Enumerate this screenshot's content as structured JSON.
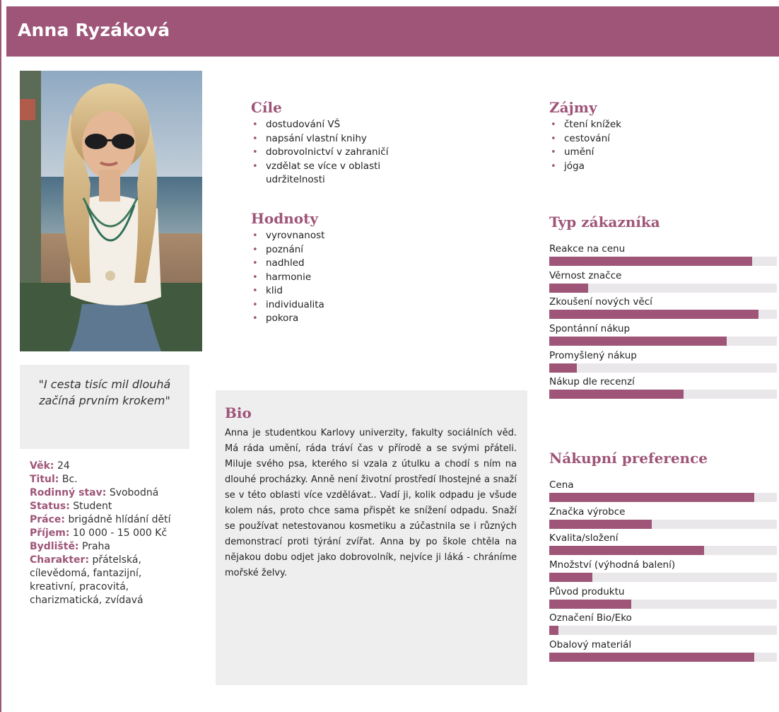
{
  "header": {
    "name": "Anna Ryzáková"
  },
  "quote": "\"I cesta tisíc mil dlouhá začíná prvním krokem\"",
  "info": [
    {
      "key": "Věk:",
      "value": "24"
    },
    {
      "key": "Titul:",
      "value": "Bc."
    },
    {
      "key": "Rodinný stav:",
      "value": "Svobodná"
    },
    {
      "key": "Status:",
      "value": "Student"
    },
    {
      "key": "Práce:",
      "value": "brigádně hlídání dětí"
    },
    {
      "key": "Příjem:",
      "value": "10 000 - 15 000 Kč"
    },
    {
      "key": "Bydliště:",
      "value": "Praha"
    },
    {
      "key": "Charakter:",
      "value": "přátelská, cílevědomá, fantazijní, kreativní, pracovitá, charizmatická, zvídavá"
    }
  ],
  "goals": {
    "title": "Cíle",
    "items": [
      "dostudování VŠ",
      "napsání vlastní knihy",
      "dobrovolnictví v zahraničí",
      "vzdělat se více v oblasti udržitelnosti"
    ]
  },
  "values": {
    "title": "Hodnoty",
    "items": [
      "vyrovnanost",
      "poznání",
      "nadhled",
      "harmonie",
      "klid",
      "individualita",
      "pokora"
    ]
  },
  "interests": {
    "title": "Zájmy",
    "items": [
      "čtení knížek",
      "cestování",
      "umění",
      "jóga"
    ]
  },
  "bio": {
    "title": "Bio",
    "text": "Anna je studentkou Karlovy univerzity, fakulty sociálních věd. Má ráda umění, ráda tráví čas v přírodě a se svými přáteli. Miluje svého psa, kterého si vzala z útulku a chodí s ním na dlouhé procházky. Anně není životní prostředí lhostejné a snaží se v této oblasti více vzdělávat.. Vadí ji, kolik odpadu je všude kolem nás, proto chce sama přispět ke snížení odpadu. Snaží se používat netestovanou kosmetiku a zúčastnila se i různých demonstrací proti týrání zvířat. Anna by po škole chtěla na nějakou dobu odjet jako dobrovolník, nejvíce ji láká - chráníme mořské želvy."
  },
  "customer_type": {
    "title": "Typ zákazníka",
    "bars": [
      {
        "label": "Reakce na cenu",
        "level": 0.89
      },
      {
        "label": "Věrnost značce",
        "level": 0.17
      },
      {
        "label": "Zkoušení nových věcí",
        "level": 0.92
      },
      {
        "label": "Spontánní nákup",
        "level": 0.78
      },
      {
        "label": "Promyšlený nákup",
        "level": 0.12
      },
      {
        "label": "Nákup dle recenzí",
        "level": 0.59
      }
    ]
  },
  "shopping_prefs": {
    "title": "Nákupní preference",
    "bars": [
      {
        "label": "Cena",
        "level": 0.9
      },
      {
        "label": "Značka výrobce",
        "level": 0.45
      },
      {
        "label": "Kvalita/složení",
        "level": 0.68
      },
      {
        "label": "Množství (výhodná balení)",
        "level": 0.19
      },
      {
        "label": "Původ produktu",
        "level": 0.36
      },
      {
        "label": "Označení Bio/Eko",
        "level": 0.04
      },
      {
        "label": "Obalový materiál",
        "level": 0.9
      }
    ]
  },
  "colors": {
    "accent": "#9e5578",
    "panel": "#eeeeef",
    "track": "#e9e7ea"
  }
}
